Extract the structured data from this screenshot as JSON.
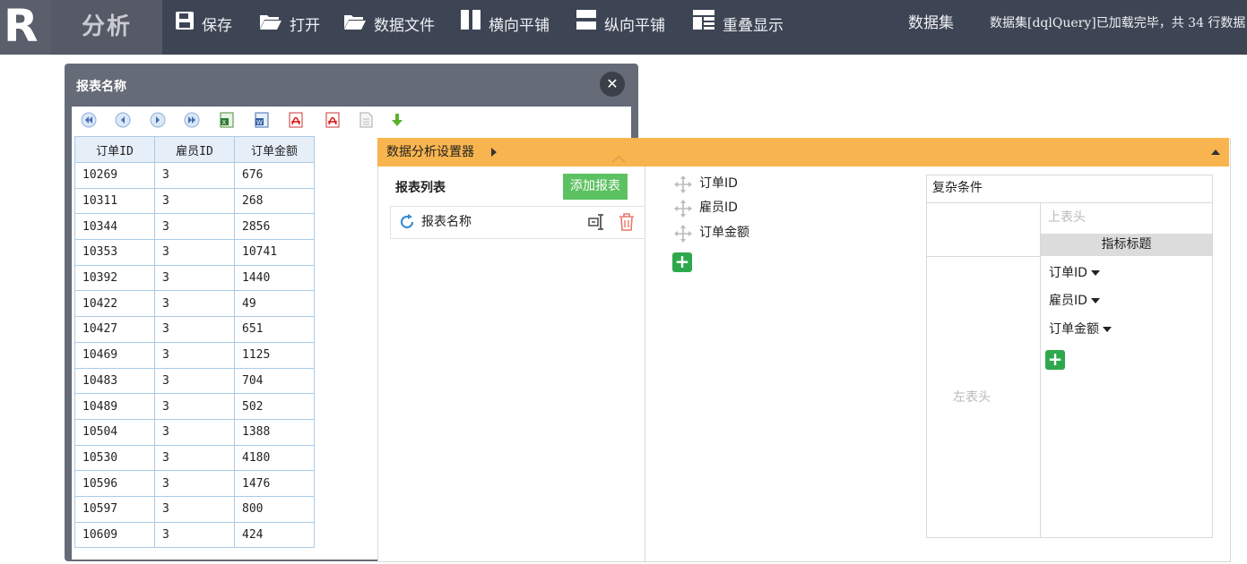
{
  "topbar": {
    "logo_letter": "R",
    "app_name": "分析",
    "tools": {
      "save": "保存",
      "open": "打开",
      "data_file": "数据文件",
      "tile_horizontal": "横向平铺",
      "tile_vertical": "纵向平铺",
      "cascade": "重叠显示"
    },
    "dataset_label": "数据集",
    "dataset_status": "数据集[dqlQuery]已加载完毕，共 34 行数据"
  },
  "report_window": {
    "title": "报表名称",
    "close_glyph": "✕",
    "columns": [
      "订单ID",
      "雇员ID",
      "订单金额"
    ],
    "rows": [
      [
        "10269",
        "3",
        "676"
      ],
      [
        "10311",
        "3",
        "268"
      ],
      [
        "10344",
        "3",
        "2856"
      ],
      [
        "10353",
        "3",
        "10741"
      ],
      [
        "10392",
        "3",
        "1440"
      ],
      [
        "10422",
        "3",
        "49"
      ],
      [
        "10427",
        "3",
        "651"
      ],
      [
        "10469",
        "3",
        "1125"
      ],
      [
        "10483",
        "3",
        "704"
      ],
      [
        "10489",
        "3",
        "502"
      ],
      [
        "10504",
        "3",
        "1388"
      ],
      [
        "10530",
        "3",
        "4180"
      ],
      [
        "10596",
        "3",
        "1476"
      ],
      [
        "10597",
        "3",
        "800"
      ],
      [
        "10609",
        "3",
        "424"
      ]
    ]
  },
  "analysis_panel": {
    "title": "数据分析设置器",
    "report_list_title": "报表列表",
    "add_report_label": "添加报表",
    "reports": [
      "报表名称"
    ],
    "fields": [
      "订单ID",
      "雇员ID",
      "订单金额"
    ],
    "add_glyph": "+",
    "condition_title": "复杂条件",
    "top_header_placeholder": "上表头",
    "metric_title": "指标标题",
    "left_header_placeholder": "左表头",
    "measures": [
      "订单ID",
      "雇员ID",
      "订单金额"
    ]
  },
  "colors": {
    "topbar": "#3d4453",
    "panel_header": "#f8b44e",
    "add_report": "#5cc261",
    "add_button": "#2ea84d",
    "grid_border": "#a9cbea"
  }
}
